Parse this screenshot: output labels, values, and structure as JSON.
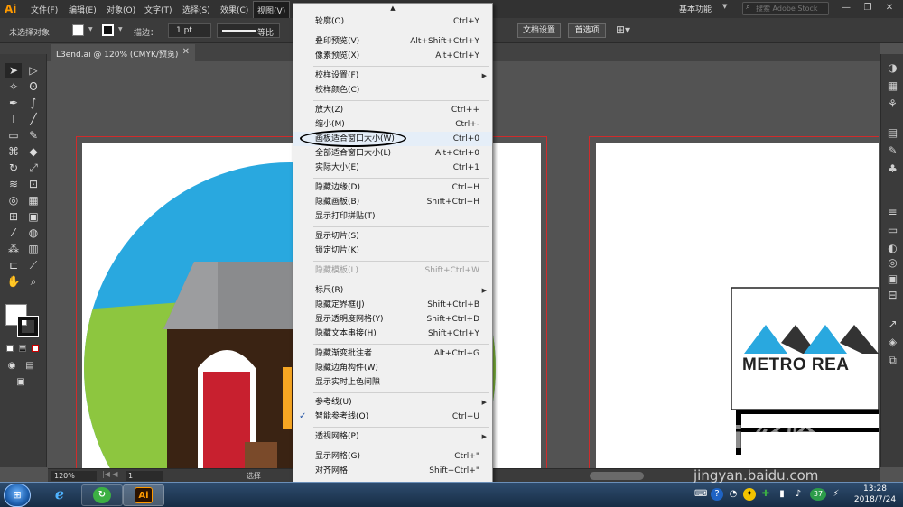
{
  "app": {
    "logo": "Ai",
    "menus": [
      "文件(F)",
      "编辑(E)",
      "对象(O)",
      "文字(T)",
      "选择(S)",
      "效果(C)",
      "视图(V)"
    ],
    "active_menu": "视图(V)",
    "workspace": "基本功能",
    "stock_search_placeholder": "搜索 Adobe Stock",
    "window_controls": [
      "—",
      "❐",
      "✕"
    ]
  },
  "control_bar": {
    "selection_label": "未选择对象",
    "stroke_label": "描边：",
    "stroke_weight": "1 pt",
    "stroke_style": "等比",
    "document_setup": "文档设置",
    "preferences": "首选项"
  },
  "document": {
    "tab_title": "L3end.ai @ 120% (CMYK/预览)",
    "tab_close": "✕"
  },
  "status_bar": {
    "zoom": "120%",
    "artboard_number": "1",
    "status": "选择"
  },
  "artwork": {
    "logo_text": "METRO REA"
  },
  "view_menu": {
    "scroll_up": "▲",
    "scroll_down": "▼",
    "items": [
      {
        "label": "轮廓(O)",
        "shortcut": "Ctrl+Y"
      },
      {
        "label": "叠印预览(V)",
        "shortcut": "Alt+Shift+Ctrl+Y"
      },
      {
        "label": "像素预览(X)",
        "shortcut": "Alt+Ctrl+Y"
      },
      {
        "label": "校样设置(F)",
        "shortcut": "",
        "submenu": true
      },
      {
        "label": "校样颜色(C)",
        "shortcut": ""
      },
      {
        "label": "放大(Z)",
        "shortcut": "Ctrl++"
      },
      {
        "label": "缩小(M)",
        "shortcut": "Ctrl+-"
      },
      {
        "label": "画板适合窗口大小(W)",
        "shortcut": "Ctrl+0",
        "highlighted": true
      },
      {
        "label": "全部适合窗口大小(L)",
        "shortcut": "Alt+Ctrl+0"
      },
      {
        "label": "实际大小(E)",
        "shortcut": "Ctrl+1"
      },
      {
        "label": "隐藏边缘(D)",
        "shortcut": "Ctrl+H"
      },
      {
        "label": "隐藏画板(B)",
        "shortcut": "Shift+Ctrl+H"
      },
      {
        "label": "显示打印拼贴(T)",
        "shortcut": ""
      },
      {
        "label": "显示切片(S)",
        "shortcut": ""
      },
      {
        "label": "锁定切片(K)",
        "shortcut": ""
      },
      {
        "label": "隐藏模板(L)",
        "shortcut": "Shift+Ctrl+W",
        "disabled": true
      },
      {
        "label": "标尺(R)",
        "shortcut": "",
        "submenu": true
      },
      {
        "label": "隐藏定界框(J)",
        "shortcut": "Shift+Ctrl+B"
      },
      {
        "label": "显示透明度网格(Y)",
        "shortcut": "Shift+Ctrl+D"
      },
      {
        "label": "隐藏文本串接(H)",
        "shortcut": "Shift+Ctrl+Y"
      },
      {
        "label": "隐藏渐变批注者",
        "shortcut": "Alt+Ctrl+G"
      },
      {
        "label": "隐藏边角构件(W)",
        "shortcut": ""
      },
      {
        "label": "显示实时上色间隙",
        "shortcut": ""
      },
      {
        "label": "参考线(U)",
        "shortcut": "",
        "submenu": true
      },
      {
        "label": "智能参考线(Q)",
        "shortcut": "Ctrl+U",
        "checked": true
      },
      {
        "label": "透视网格(P)",
        "shortcut": "",
        "submenu": true
      },
      {
        "label": "显示网格(G)",
        "shortcut": "Ctrl+\""
      },
      {
        "label": "对齐网格",
        "shortcut": "Shift+Ctrl+\""
      }
    ]
  },
  "taskbar": {
    "start": "⊞",
    "illustrator_glyph": "Ai",
    "tray_badge": "37",
    "time": "13:28",
    "date": "2018/7/24"
  },
  "watermark": {
    "brand": "Bai 经验",
    "url": "jingyan.baidu.com"
  },
  "colors": {
    "sky": "#29a8df",
    "grass": "#8dc63f",
    "house": "#3a2313",
    "roof": "#8a8b8d",
    "door": "#c8202f",
    "artboard_border": "#d02b2b"
  }
}
